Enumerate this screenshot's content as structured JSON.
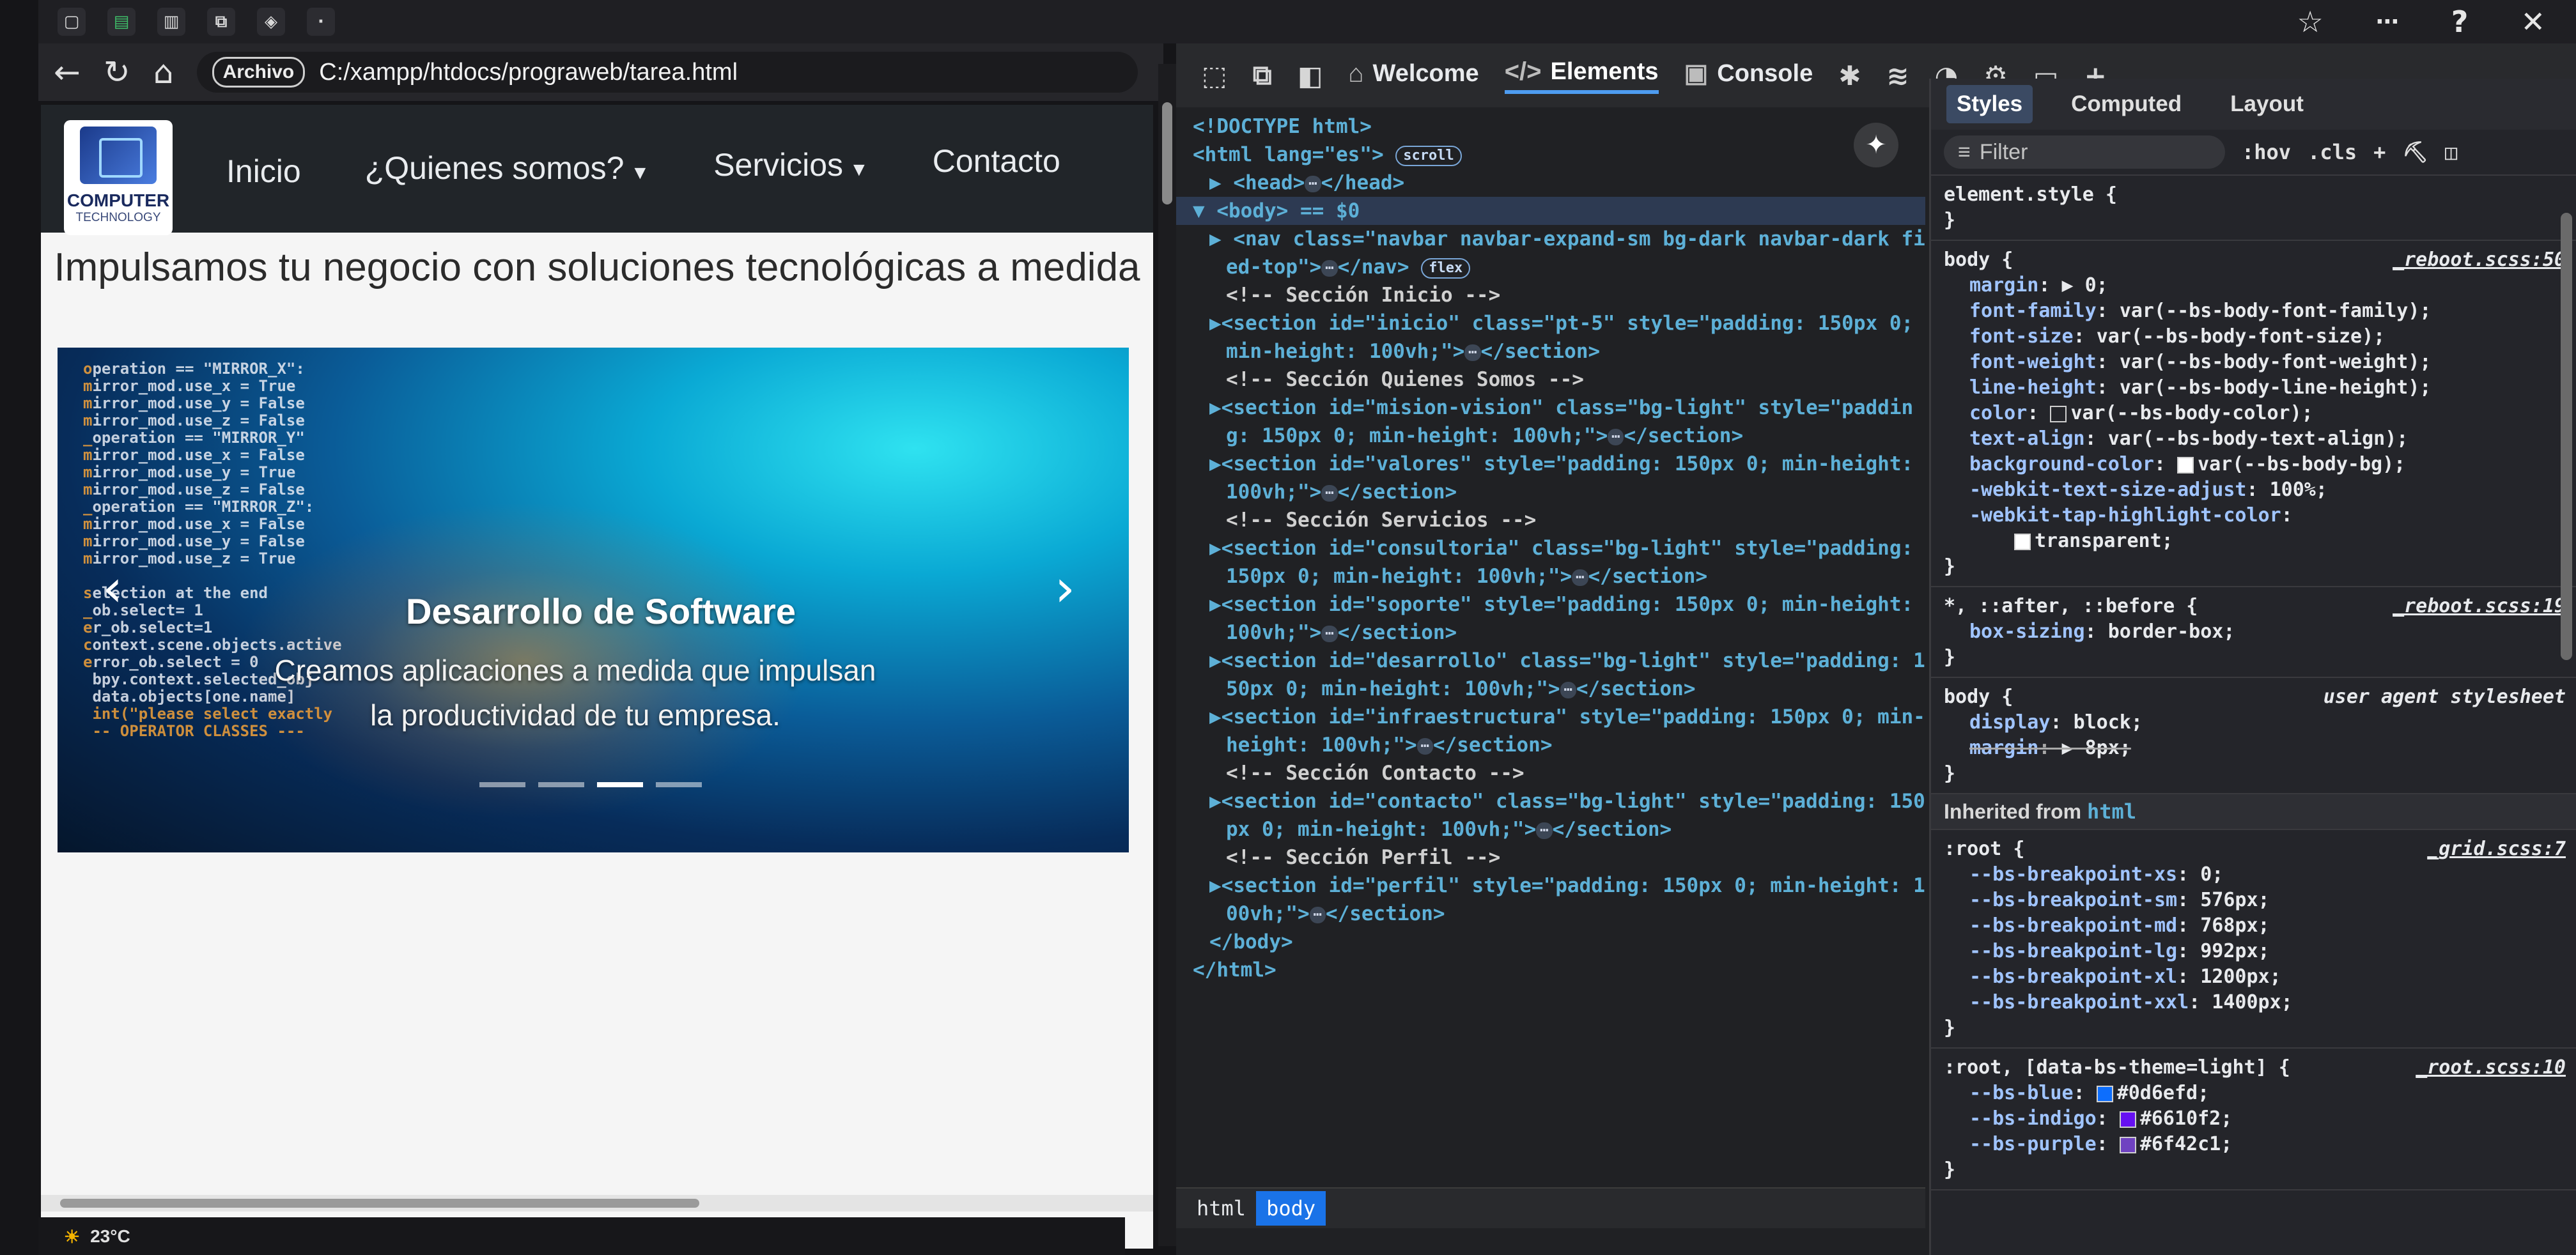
{
  "browser": {
    "tab_icons": [
      "window-icon",
      "excel-icon",
      "file-icon",
      "copy-icon",
      "shield-icon",
      "blank-icon"
    ],
    "protocol_label": "Archivo",
    "url": "C:/xampp/htdocs/prograweb/tarea.html",
    "status_temp": "23°C"
  },
  "page": {
    "logo": {
      "title": "COMPUTER",
      "subtitle": "TECHNOLOGY"
    },
    "nav": [
      {
        "label": "Inicio",
        "dropdown": false
      },
      {
        "label": "¿Quienes somos?",
        "dropdown": true
      },
      {
        "label": "Servicios",
        "dropdown": true
      },
      {
        "label": "Contacto",
        "dropdown": false
      }
    ],
    "hero_title": "Impulsamos tu negocio con soluciones tecnológicas a medida",
    "carousel": {
      "caption_title": "Desarrollo de Software",
      "caption_text": "Creamos aplicaciones a medida que impulsan la productividad de tu empresa.",
      "prev_glyph": "‹",
      "next_glyph": "›",
      "slide_count": 4,
      "active_index": 2
    }
  },
  "devtools": {
    "tabs": [
      {
        "label": "Welcome",
        "icon": "home-icon",
        "active": false
      },
      {
        "label": "Elements",
        "icon": "code-icon",
        "active": true
      },
      {
        "label": "Console",
        "icon": "console-icon",
        "active": false
      }
    ],
    "elements_lines": [
      {
        "t": "<!DOCTYPE html>",
        "indent": 0
      },
      {
        "t": "<html lang=\"es\">",
        "badge": "scroll",
        "indent": 0
      },
      {
        "t": "▶ <head>",
        "dots": true,
        "tail": "</head>",
        "indent": 1
      },
      {
        "t": "▼ <body> == $0",
        "indent": 0,
        "selected": true
      },
      {
        "t": "▶ <nav class=\"navbar navbar-expand-sm bg-dark navbar-dark fix",
        "indent": 1
      },
      {
        "t": "ed-top\">",
        "dots": true,
        "tail": "</nav>",
        "badge": "flex",
        "indent": 2
      },
      {
        "t": "<!-- Sección Inicio -->",
        "indent": 2,
        "comment": true
      },
      {
        "t": "▶<section id=\"inicio\" class=\"pt-5\" style=\"padding: 150px 0;",
        "indent": 1
      },
      {
        "t": "min-height: 100vh;\">",
        "dots": true,
        "tail": "</section>",
        "indent": 2
      },
      {
        "t": "<!-- Sección Quienes Somos -->",
        "indent": 2,
        "comment": true
      },
      {
        "t": "▶<section id=\"mision-vision\" class=\"bg-light\" style=\"paddin",
        "indent": 1
      },
      {
        "t": "g: 150px 0; min-height: 100vh;\">",
        "dots": true,
        "tail": "</section>",
        "indent": 2
      },
      {
        "t": "▶<section id=\"valores\" style=\"padding: 150px 0; min-height:",
        "indent": 1
      },
      {
        "t": "100vh;\">",
        "dots": true,
        "tail": "</section>",
        "indent": 2
      },
      {
        "t": "<!-- Sección Servicios -->",
        "indent": 2,
        "comment": true
      },
      {
        "t": "▶<section id=\"consultoria\" class=\"bg-light\" style=\"padding:",
        "indent": 1
      },
      {
        "t": "150px 0; min-height: 100vh;\">",
        "dots": true,
        "tail": "</section>",
        "indent": 2
      },
      {
        "t": "▶<section id=\"soporte\" style=\"padding: 150px 0; min-height:",
        "indent": 1
      },
      {
        "t": "100vh;\">",
        "dots": true,
        "tail": "</section>",
        "indent": 2
      },
      {
        "t": "▶<section id=\"desarrollo\" class=\"bg-light\" style=\"padding: 1",
        "indent": 1
      },
      {
        "t": "50px 0; min-height: 100vh;\">",
        "dots": true,
        "tail": "</section>",
        "indent": 2
      },
      {
        "t": "▶<section id=\"infraestructura\" style=\"padding: 150px 0; min-",
        "indent": 1
      },
      {
        "t": "height: 100vh;\">",
        "dots": true,
        "tail": "</section>",
        "indent": 2
      },
      {
        "t": "<!-- Sección Contacto -->",
        "indent": 2,
        "comment": true
      },
      {
        "t": "▶<section id=\"contacto\" class=\"bg-light\" style=\"padding: 150",
        "indent": 1
      },
      {
        "t": "px 0; min-height: 100vh;\">",
        "dots": true,
        "tail": "</section>",
        "indent": 2
      },
      {
        "t": "<!-- Sección Perfil -->",
        "indent": 2,
        "comment": true
      },
      {
        "t": "▶<section id=\"perfil\" style=\"padding: 150px 0; min-height: 1",
        "indent": 1
      },
      {
        "t": "00vh;\">",
        "dots": true,
        "tail": "</section>",
        "indent": 2
      },
      {
        "t": "</body>",
        "indent": 1
      },
      {
        "t": "</html>",
        "indent": 0
      }
    ],
    "breadcrumbs": [
      {
        "label": "html",
        "active": false
      },
      {
        "label": "body",
        "active": true
      }
    ],
    "styles": {
      "tabs": [
        {
          "label": "Styles",
          "active": true
        },
        {
          "label": "Computed",
          "active": false
        },
        {
          "label": "Layout",
          "active": false
        }
      ],
      "filter_placeholder": "Filter",
      "hov_label": ":hov",
      "cls_label": ".cls",
      "rules": [
        {
          "selector": "element.style {",
          "source": "",
          "decls": []
        },
        {
          "selector": "body {",
          "source": "_reboot.scss:50",
          "decls": [
            {
              "p": "margin",
              "v": "▶ 0;"
            },
            {
              "p": "font-family",
              "v": "var(--bs-body-font-family);"
            },
            {
              "p": "font-size",
              "v": "var(--bs-body-font-size);"
            },
            {
              "p": "font-weight",
              "v": "var(--bs-body-font-weight);"
            },
            {
              "p": "line-height",
              "v": "var(--bs-body-line-height);"
            },
            {
              "p": "color",
              "v": "var(--bs-body-color);",
              "swatch": "transparent"
            },
            {
              "p": "text-align",
              "v": "var(--bs-body-text-align);"
            },
            {
              "p": "background-color",
              "v": "var(--bs-body-bg);",
              "swatch": "#ffffff"
            },
            {
              "p": "-webkit-text-size-adjust",
              "v": "100%;"
            },
            {
              "p": "-webkit-tap-highlight-color",
              "v": ""
            },
            {
              "p": "",
              "v": "transparent;",
              "swatch": "#ffffff"
            }
          ]
        },
        {
          "selector": "*, ::after, ::before {",
          "source": "_reboot.scss:19",
          "decls": [
            {
              "p": "box-sizing",
              "v": "border-box;"
            }
          ]
        },
        {
          "selector": "body {",
          "source": "user agent stylesheet",
          "ua": true,
          "decls": [
            {
              "p": "display",
              "v": "block;"
            },
            {
              "p": "margin",
              "v": "▶ 8px;",
              "strike": true
            }
          ]
        }
      ],
      "inherited_label": "Inherited from",
      "inherited_tag": "html",
      "root_rule": {
        "selector": ":root {",
        "source": "_grid.scss:7",
        "decls": [
          {
            "p": "--bs-breakpoint-xs",
            "v": "0;"
          },
          {
            "p": "--bs-breakpoint-sm",
            "v": "576px;"
          },
          {
            "p": "--bs-breakpoint-md",
            "v": "768px;"
          },
          {
            "p": "--bs-breakpoint-lg",
            "v": "992px;"
          },
          {
            "p": "--bs-breakpoint-xl",
            "v": "1200px;"
          },
          {
            "p": "--bs-breakpoint-xxl",
            "v": "1400px;"
          }
        ]
      },
      "theme_rule": {
        "selector": ":root, [data-bs-theme=light] {",
        "source": "_root.scss:10",
        "decls": [
          {
            "p": "--bs-blue",
            "v": "#0d6efd;",
            "swatch": "#0d6efd"
          },
          {
            "p": "--bs-indigo",
            "v": "#6610f2;",
            "swatch": "#6610f2"
          },
          {
            "p": "--bs-purple",
            "v": "#6f42c1;",
            "swatch": "#6f42c1"
          }
        ]
      }
    }
  }
}
